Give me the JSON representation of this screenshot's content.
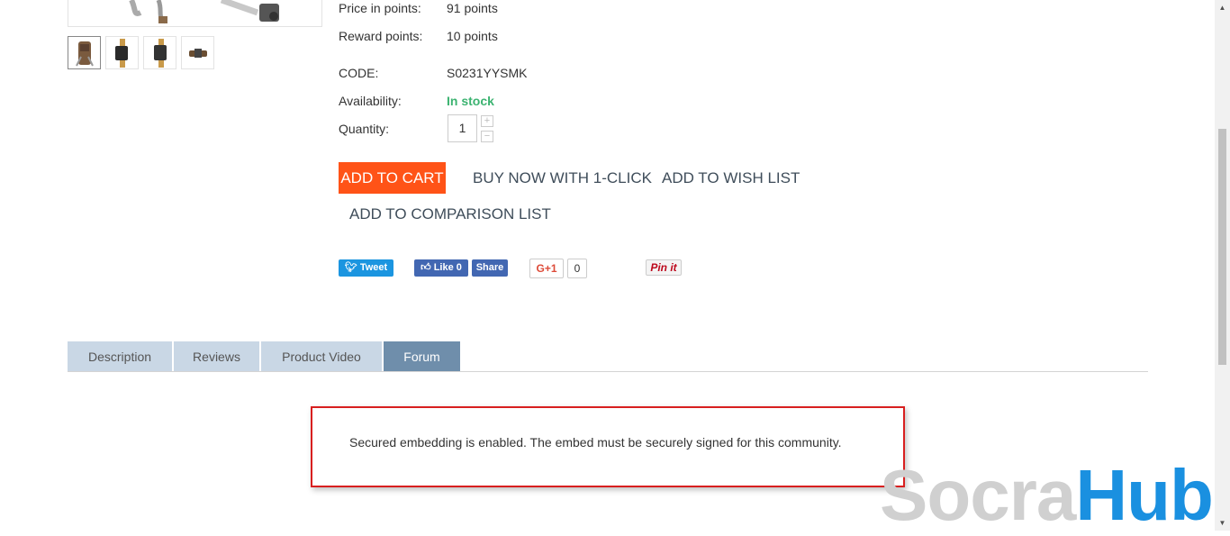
{
  "product": {
    "details": [
      {
        "label": "Price in points:",
        "value": "91 points"
      },
      {
        "label": "Reward points:",
        "value": "10 points"
      },
      {
        "label": "CODE:",
        "value": "S0231YYSMK"
      },
      {
        "label": "Availability:",
        "value": "In stock"
      }
    ],
    "quantity_label": "Quantity:",
    "quantity_value": "1",
    "qty_plus": "+",
    "qty_minus": "−"
  },
  "actions": {
    "add_to_cart": "ADD TO CART",
    "buy_now": "BUY NOW WITH 1-CLICK",
    "wish_list": "ADD TO WISH LIST",
    "comparison": "ADD TO COMPARISON LIST"
  },
  "social": {
    "tweet": "Tweet",
    "like": "Like 0",
    "share": "Share",
    "gplus": "G+1",
    "gplus_count": "0",
    "pin": "Pin it"
  },
  "tabs": [
    "Description",
    "Reviews",
    "Product Video",
    "Forum"
  ],
  "active_tab": "Forum",
  "notice": "Secured embedding is enabled. The embed must be securely signed for this community.",
  "watermark": {
    "part1": "Socra",
    "part2": "Hub"
  },
  "colors": {
    "cart": "#ff5317",
    "in_stock": "#3cb371",
    "tab_active": "#6f8eab",
    "tab": "#c9d7e5",
    "notice_border": "#d81f1f"
  }
}
